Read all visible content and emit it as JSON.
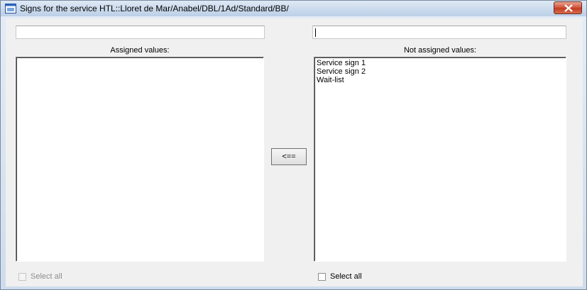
{
  "window": {
    "title": "Signs for the service HTL::Lloret de Mar/Anabel/DBL/1Ad/Standard/BB/"
  },
  "left": {
    "filter_value": "",
    "heading": "Assigned values:",
    "items": [],
    "select_all_label": "Select all",
    "select_all_enabled": false
  },
  "right": {
    "filter_value": "",
    "heading": "Not assigned values:",
    "items": [
      "Service sign 1",
      "Service sign 2",
      "Wait-list"
    ],
    "select_all_label": "Select all",
    "select_all_enabled": true
  },
  "move_button_label": "<=="
}
